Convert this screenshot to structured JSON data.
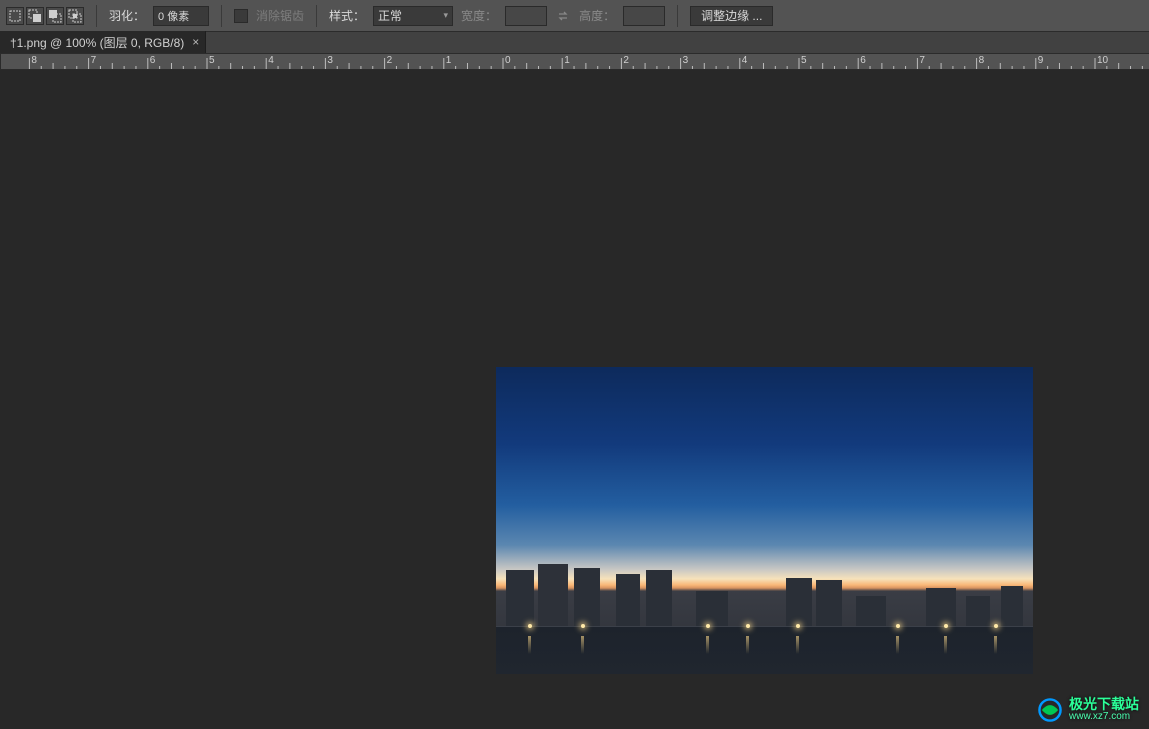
{
  "options_bar": {
    "feather_label": "羽化：",
    "feather_value": "0 像素",
    "antialias_label": "消除锯齿",
    "style_label": "样式：",
    "style_value": "正常",
    "width_label": "宽度：",
    "width_value": "",
    "height_label": "高度：",
    "height_value": "",
    "refine_edge_label": "调整边缘 ..."
  },
  "tab": {
    "title": "†1.png @ 100% (图层 0, RGB/8)",
    "close": "×"
  },
  "ruler": {
    "unit_negatives": [
      "1",
      "0"
    ],
    "units": [
      "0",
      "1",
      "2",
      "3",
      "4",
      "5",
      "6",
      "7",
      "8",
      "9",
      "10"
    ],
    "minor_per_major": 5
  },
  "watermark": {
    "line1": "极光下载站",
    "line2": "www.xz7.com"
  },
  "icons": {
    "marquee_new": "new-selection",
    "marquee_add": "add-to-selection",
    "marquee_sub": "subtract-from-selection",
    "marquee_int": "intersect-selection"
  }
}
